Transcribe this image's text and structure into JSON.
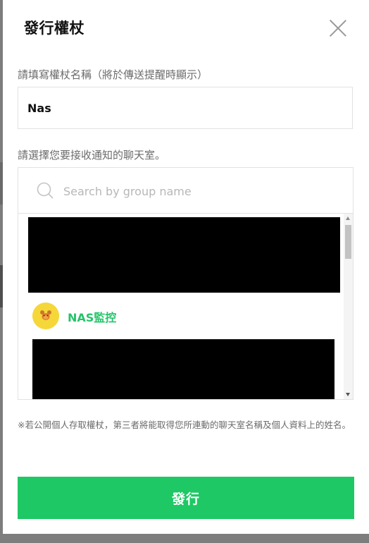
{
  "dialog": {
    "title": "發行權杖"
  },
  "token_name": {
    "label": "請填寫權杖名稱（將於傳送提醒時顯示）",
    "value": "Nas"
  },
  "chat_select": {
    "label": "請選擇您要接收通知的聊天室。",
    "search_placeholder": "Search by group name",
    "items": [
      {
        "name": "NAS監控",
        "avatar_icon": "brown-bear-avatar-icon"
      }
    ]
  },
  "notice": {
    "text": "※若公開個人存取權杖，第三者將能取得您所連動的聊天室名稱及個人資料上的姓名。"
  },
  "actions": {
    "issue_label": "發行"
  },
  "colors": {
    "accent_green": "#1ec864",
    "chat_name_green": "#25c46a",
    "avatar_yellow": "#f5d73a"
  }
}
